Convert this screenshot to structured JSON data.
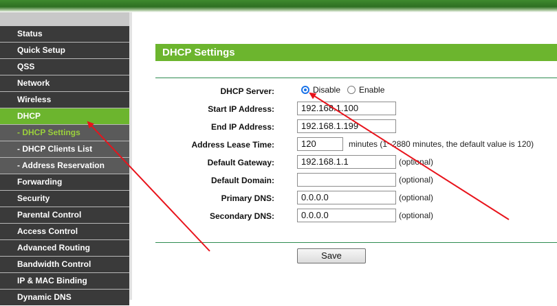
{
  "sidebar": {
    "items": [
      {
        "label": "Status",
        "type": "item"
      },
      {
        "label": "Quick Setup",
        "type": "item"
      },
      {
        "label": "QSS",
        "type": "item"
      },
      {
        "label": "Network",
        "type": "item"
      },
      {
        "label": "Wireless",
        "type": "item"
      },
      {
        "label": "DHCP",
        "type": "active"
      },
      {
        "label": "- DHCP Settings",
        "type": "sub-current"
      },
      {
        "label": "- DHCP Clients List",
        "type": "sub"
      },
      {
        "label": "- Address Reservation",
        "type": "sub"
      },
      {
        "label": "Forwarding",
        "type": "item"
      },
      {
        "label": "Security",
        "type": "item"
      },
      {
        "label": "Parental Control",
        "type": "item"
      },
      {
        "label": "Access Control",
        "type": "item"
      },
      {
        "label": "Advanced Routing",
        "type": "item"
      },
      {
        "label": "Bandwidth Control",
        "type": "item"
      },
      {
        "label": "IP & MAC Binding",
        "type": "item"
      },
      {
        "label": "Dynamic DNS",
        "type": "item"
      }
    ]
  },
  "main": {
    "title": "DHCP Settings",
    "dhcp_server": {
      "label": "DHCP Server:",
      "options": [
        "Disable",
        "Enable"
      ],
      "selected": "Disable"
    },
    "start_ip": {
      "label": "Start IP Address:",
      "value": "192.168.1.100"
    },
    "end_ip": {
      "label": "End IP Address:",
      "value": "192.168.1.199"
    },
    "lease": {
      "label": "Address Lease Time:",
      "value": "120",
      "hint": "minutes (1~2880 minutes, the default value is 120)"
    },
    "gateway": {
      "label": "Default Gateway:",
      "value": "192.168.1.1",
      "hint": "(optional)"
    },
    "domain": {
      "label": "Default Domain:",
      "value": "",
      "hint": "(optional)"
    },
    "primary_dns": {
      "label": "Primary DNS:",
      "value": "0.0.0.0",
      "hint": "(optional)"
    },
    "secondary_dns": {
      "label": "Secondary DNS:",
      "value": "0.0.0.0",
      "hint": "(optional)"
    },
    "save_label": "Save"
  },
  "colors": {
    "accent_green": "#6cb52e",
    "menu_dark": "#3a3a3a",
    "annotation_arrow": "#e8131b",
    "radio_selected": "#1a73e8"
  }
}
